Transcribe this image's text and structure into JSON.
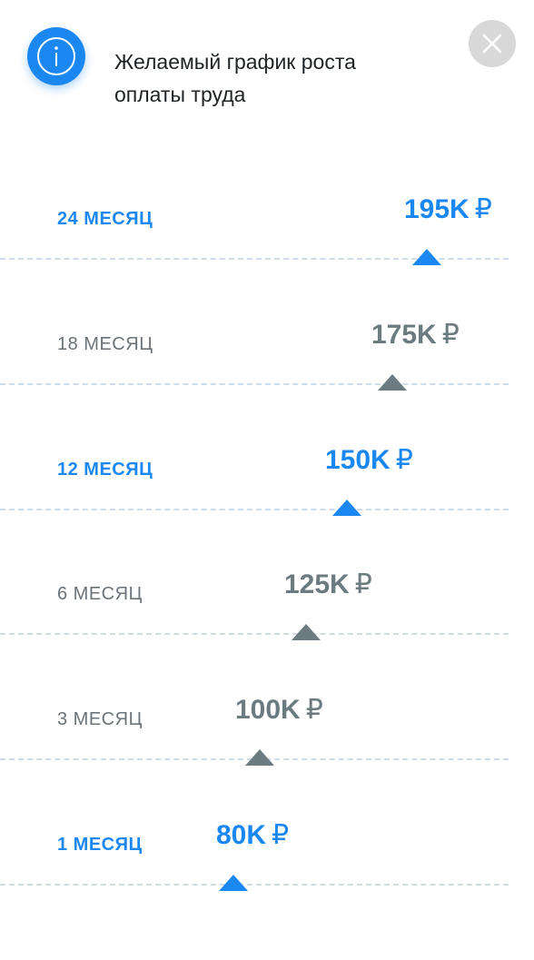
{
  "header": {
    "title": "Желаемый график роста оплаты труда",
    "info_icon": "info-icon",
    "close_icon": "close-icon"
  },
  "colors": {
    "accent": "#1b87f0",
    "muted": "#6b7b80",
    "divider": "#cfdbe6",
    "close_bg": "#d8d8d8"
  },
  "milestones": [
    {
      "month": "24 МЕСЯЦ",
      "salary": "195K",
      "currency": "₽",
      "highlight": true
    },
    {
      "month": "18 МЕСЯЦ",
      "salary": "175K",
      "currency": "₽",
      "highlight": false
    },
    {
      "month": "12 МЕСЯЦ",
      "salary": "150K",
      "currency": "₽",
      "highlight": true
    },
    {
      "month": "6 МЕСЯЦ",
      "salary": "125K",
      "currency": "₽",
      "highlight": false
    },
    {
      "month": "3 МЕСЯЦ",
      "salary": "100K",
      "currency": "₽",
      "highlight": false
    },
    {
      "month": "1 МЕСЯЦ",
      "salary": "80K",
      "currency": "₽",
      "highlight": true
    }
  ]
}
